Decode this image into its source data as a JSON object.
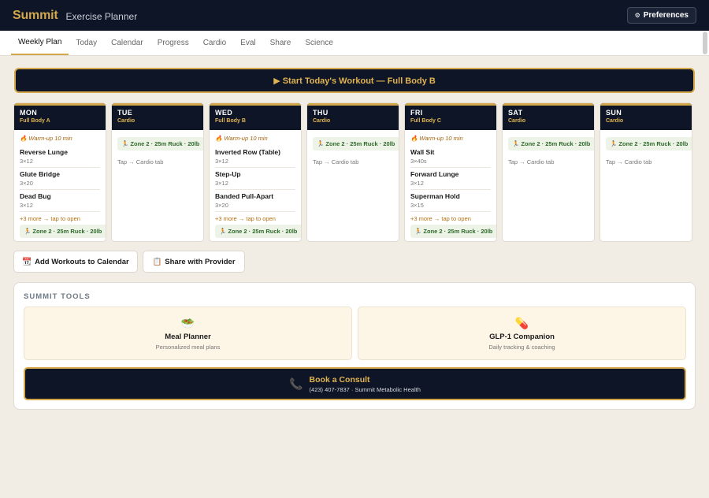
{
  "header": {
    "logo": "Summit",
    "app_title": "Exercise Planner",
    "preferences_label": "Preferences",
    "gear_glyph": "⚙"
  },
  "tabs": [
    {
      "label": "Weekly Plan",
      "active": true
    },
    {
      "label": "Today"
    },
    {
      "label": "Calendar"
    },
    {
      "label": "Progress"
    },
    {
      "label": "Cardio"
    },
    {
      "label": "Eval"
    },
    {
      "label": "Share"
    },
    {
      "label": "Science"
    }
  ],
  "start_workout": {
    "label": "▶ Start Today's Workout — Full Body B"
  },
  "cardio_zone": "🏃 Zone 2 · 25m Ruck · 20lb",
  "tap_text": "Tap → Cardio tab",
  "days": [
    {
      "day": "MON",
      "type": "Full Body A",
      "warmup": "🔥 Warm-up 10 min",
      "exercises": [
        {
          "name": "Reverse Lunge",
          "sets": "3×12"
        },
        {
          "name": "Glute Bridge",
          "sets": "3×20"
        },
        {
          "name": "Dead Bug",
          "sets": "3×12"
        }
      ],
      "more": "+3 more → tap to open"
    },
    {
      "day": "TUE",
      "type": "Cardio"
    },
    {
      "day": "WED",
      "type": "Full Body B",
      "warmup": "🔥 Warm-up 10 min",
      "exercises": [
        {
          "name": "Inverted Row (Table)",
          "sets": "3×12"
        },
        {
          "name": "Step-Up",
          "sets": "3×12"
        },
        {
          "name": "Banded Pull-Apart",
          "sets": "3×20"
        }
      ],
      "more": "+3 more → tap to open"
    },
    {
      "day": "THU",
      "type": "Cardio"
    },
    {
      "day": "FRI",
      "type": "Full Body C",
      "warmup": "🔥 Warm-up 10 min",
      "exercises": [
        {
          "name": "Wall Sit",
          "sets": "3×40s"
        },
        {
          "name": "Forward Lunge",
          "sets": "3×12"
        },
        {
          "name": "Superman Hold",
          "sets": "3×15"
        }
      ],
      "more": "+3 more → tap to open"
    },
    {
      "day": "SAT",
      "type": "Cardio"
    },
    {
      "day": "SUN",
      "type": "Cardio"
    }
  ],
  "actions": {
    "calendar_label": "Add Workouts to Calendar",
    "calendar_icon": "📆",
    "share_label": "Share with Provider",
    "share_icon": "📋"
  },
  "tools": {
    "title": "SUMMIT TOOLS",
    "meal": {
      "icon": "🥗",
      "name": "Meal Planner",
      "desc": "Personalized meal plans"
    },
    "glp": {
      "icon": "💊",
      "name": "GLP-1 Companion",
      "desc": "Daily tracking & coaching"
    },
    "consult": {
      "icon": "📞",
      "title": "Book a Consult",
      "sub": "(423) 407-7837 · Summit Metabolic Health"
    }
  },
  "colors": {
    "navy": "#0d1526",
    "gold": "#d4a84a",
    "cream": "#fdf5e6",
    "background": "#f1ede5",
    "zone_green": "#2e6b2b"
  }
}
